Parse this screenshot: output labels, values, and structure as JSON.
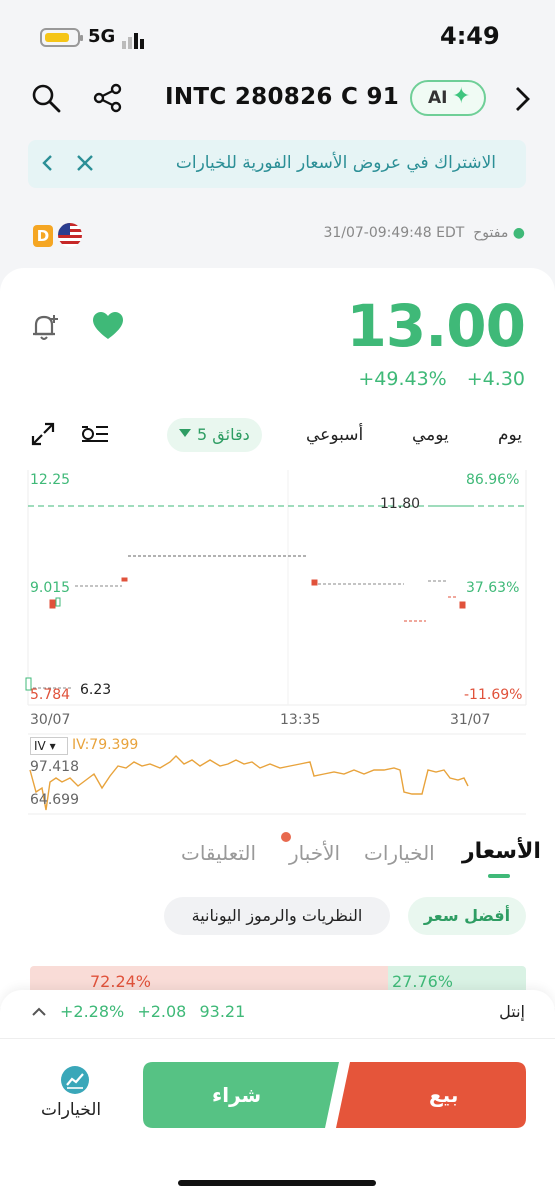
{
  "status_bar": {
    "time": "4:49",
    "network": "5G"
  },
  "header": {
    "title": "INTC 280826 C 91",
    "ai_label": "AI"
  },
  "banner": {
    "text": "الاشتراك في عروض الأسعار الفورية للخيارات"
  },
  "market": {
    "status": "مفتوح",
    "timestamp": "31/07-09:49:48 EDT",
    "badge": "D"
  },
  "quote": {
    "price": "13.00",
    "change_pct": "+49.43%",
    "change_abs": "+4.30"
  },
  "periods": {
    "day": "يوم",
    "daily": "يومي",
    "weekly": "أسبوعي",
    "selected": "5 دقائق"
  },
  "chart_data": {
    "type": "line",
    "y_left_labels": [
      "12.25",
      "9.015",
      "5.784"
    ],
    "y_right_labels": [
      "86.96%",
      "37.63%",
      "-11.69%"
    ],
    "x_labels": [
      "30/07",
      "13:35",
      "31/07"
    ],
    "marker_high": "11.80",
    "marker_low": "6.23",
    "ylim": [
      5.784,
      12.25
    ]
  },
  "iv_chart": {
    "selector": "IV",
    "value_label": "IV:79.399",
    "max": "97.418",
    "min": "64.699"
  },
  "tabs": {
    "prices": "الأسعار",
    "options": "الخيارات",
    "news": "الأخبار",
    "comments": "التعليقات"
  },
  "chips": {
    "best_price": "أفضل سعر",
    "greeks": "النظريات والرموز اليونانية"
  },
  "bid_ask": {
    "left": "72.24%",
    "right": "27.76%"
  },
  "ticker": {
    "name": "إنتل",
    "price": "93.21",
    "change": "+2.08",
    "change_pct": "+2.28%"
  },
  "actions": {
    "buy": "شراء",
    "sell": "بيع",
    "options": "الخيارات"
  }
}
